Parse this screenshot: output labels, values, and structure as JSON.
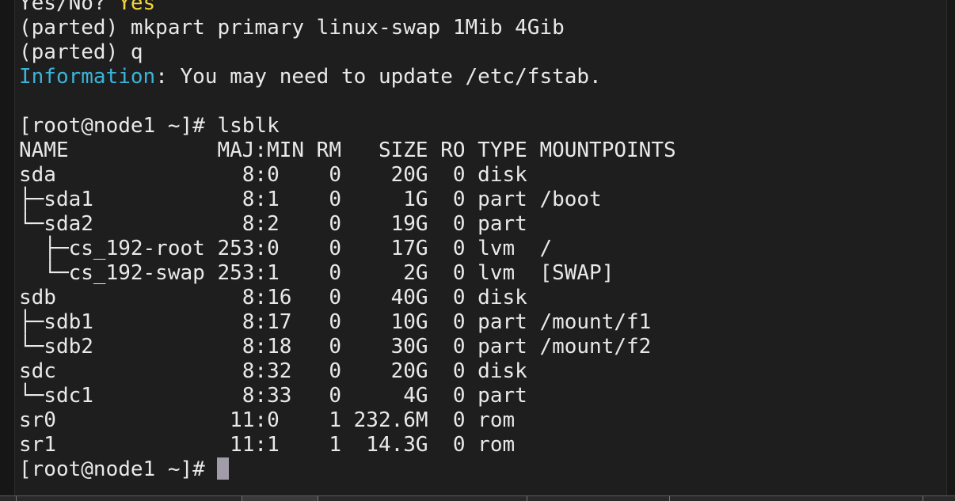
{
  "terminal": {
    "lines": [
      {
        "parts": [
          {
            "t": "Yes/No? "
          },
          {
            "t": "Yes",
            "c": "ans"
          }
        ]
      },
      {
        "parts": [
          {
            "t": "(parted) mkpart primary linux-swap 1Mib 4Gib"
          }
        ]
      },
      {
        "parts": [
          {
            "t": "(parted) q"
          }
        ]
      },
      {
        "parts": [
          {
            "t": "Information",
            "c": "info"
          },
          {
            "t": ": You may need to update /etc/fstab."
          }
        ]
      },
      {
        "parts": [
          {
            "t": ""
          }
        ]
      },
      {
        "parts": [
          {
            "t": "[root@node1 ~]# lsblk"
          }
        ]
      },
      {
        "parts": [
          {
            "t": "NAME            MAJ:MIN RM   SIZE RO TYPE MOUNTPOINTS"
          }
        ]
      },
      {
        "parts": [
          {
            "t": "sda               8:0    0    20G  0 disk"
          }
        ]
      },
      {
        "parts": [
          {
            "t": "├─sda1            8:1    0     1G  0 part /boot"
          }
        ]
      },
      {
        "parts": [
          {
            "t": "└─sda2            8:2    0    19G  0 part"
          }
        ]
      },
      {
        "parts": [
          {
            "t": "  ├─cs_192-root 253:0    0    17G  0 lvm  /"
          }
        ]
      },
      {
        "parts": [
          {
            "t": "  └─cs_192-swap 253:1    0     2G  0 lvm  [SWAP]"
          }
        ]
      },
      {
        "parts": [
          {
            "t": "sdb               8:16   0    40G  0 disk"
          }
        ]
      },
      {
        "parts": [
          {
            "t": "├─sdb1            8:17   0    10G  0 part /mount/f1"
          }
        ]
      },
      {
        "parts": [
          {
            "t": "└─sdb2            8:18   0    30G  0 part /mount/f2"
          }
        ]
      },
      {
        "parts": [
          {
            "t": "sdc               8:32   0    20G  0 disk"
          }
        ]
      },
      {
        "parts": [
          {
            "t": "└─sdc1            8:33   0     4G  0 part"
          }
        ]
      },
      {
        "parts": [
          {
            "t": "sr0              11:0    1 232.6M  0 rom"
          }
        ]
      },
      {
        "parts": [
          {
            "t": "sr1              11:1    1  14.3G  0 rom"
          }
        ]
      }
    ],
    "prompt": "[root@node1 ~]# ",
    "colors": {
      "background": "#1e1e1e",
      "foreground": "#e9e9e9",
      "answer": "#f2d53c",
      "info": "#3ab4d9",
      "cursor": "#a09ca8"
    }
  }
}
